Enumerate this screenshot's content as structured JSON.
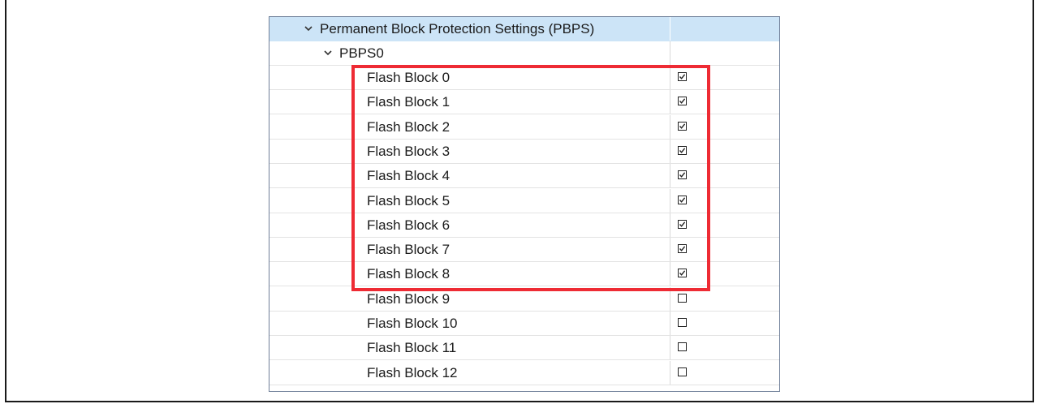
{
  "tree": {
    "section": {
      "label": "Permanent Block Protection Settings (PBPS)",
      "expanded": true
    },
    "group": {
      "label": "PBPS0",
      "expanded": true
    },
    "items": [
      {
        "label": "Flash Block 0",
        "checked": true
      },
      {
        "label": "Flash Block 1",
        "checked": true
      },
      {
        "label": "Flash Block 2",
        "checked": true
      },
      {
        "label": "Flash Block 3",
        "checked": true
      },
      {
        "label": "Flash Block 4",
        "checked": true
      },
      {
        "label": "Flash Block 5",
        "checked": true
      },
      {
        "label": "Flash Block 6",
        "checked": true
      },
      {
        "label": "Flash Block 7",
        "checked": true
      },
      {
        "label": "Flash Block 8",
        "checked": true
      },
      {
        "label": "Flash Block 9",
        "checked": false
      },
      {
        "label": "Flash Block 10",
        "checked": false
      },
      {
        "label": "Flash Block 11",
        "checked": false
      },
      {
        "label": "Flash Block 12",
        "checked": false
      }
    ]
  },
  "colors": {
    "selection": "#cce4f7",
    "highlight": "#ee2b34",
    "border": "#6f7f99"
  },
  "icons": {
    "expand": "chevron-down-icon",
    "checkbox": "checkbox-icon"
  }
}
